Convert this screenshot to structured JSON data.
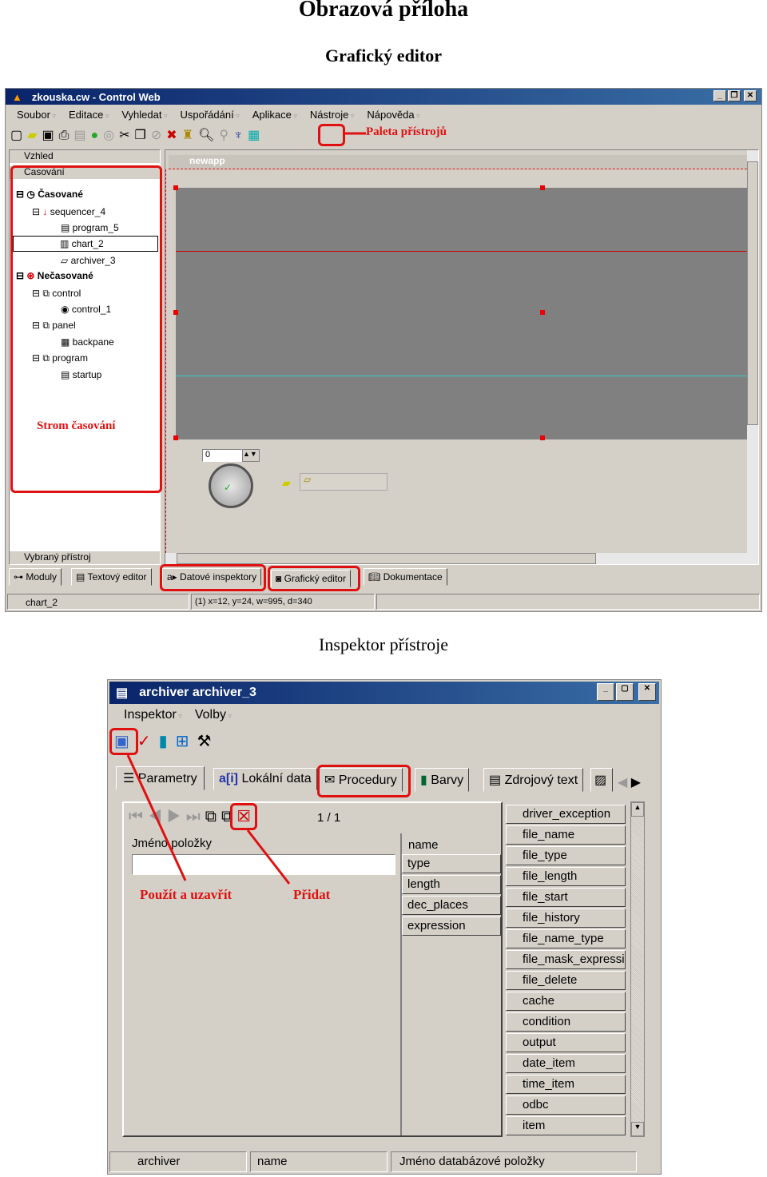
{
  "page": {
    "title": "Obrazová příloha",
    "section1": "Grafický editor",
    "section2": "Inspektor přístroje"
  },
  "editor": {
    "window_title": "zkouska.cw - Control Web",
    "menu": [
      "Soubor",
      "Editace",
      "Vyhledat",
      "Uspořádání",
      "Aplikace",
      "Nástroje",
      "Nápověda"
    ],
    "annotation_palette": "Paleta přístrojů",
    "left_headers": {
      "view": "Vzhled",
      "timing": "Časování",
      "selected": "Vybraný přístroj"
    },
    "tree": [
      "Časované",
      "sequencer_4",
      "program_5",
      "chart_2",
      "archiver_3",
      "Nečasované",
      "control",
      "control_1",
      "panel",
      "backpane",
      "program",
      "startup"
    ],
    "annotation_tree": "Strom časování",
    "canvas_title": "newapp",
    "spin_value": "0",
    "tabs": [
      "Moduly",
      "Textový editor",
      "Datové inspektory",
      "Grafický editor",
      "Dokumentace"
    ],
    "status": {
      "item": "chart_2",
      "coords": "(1) x=12, y=24, w=995, d=340"
    },
    "colors": {
      "annotation": "#e01010",
      "titlebar": "#0a246a",
      "chart_bg": "#808080"
    }
  },
  "inspector": {
    "window_title": "archiver archiver_3",
    "menu": [
      "Inspektor",
      "Volby"
    ],
    "tabs": [
      "Parametry",
      "Lokální data",
      "Procedury",
      "Barvy",
      "Zdrojový text"
    ],
    "page_counter": "1 / 1",
    "field_label": "Jméno položky",
    "field_value": "",
    "annotation_apply": "Použít a uzavřít",
    "annotation_add": "Přidat",
    "columns": [
      "name",
      "type",
      "length",
      "dec_places",
      "expression"
    ],
    "procedures": [
      "driver_exception",
      "file_name",
      "file_type",
      "file_length",
      "file_start",
      "file_history",
      "file_name_type",
      "file_mask_expressi",
      "file_delete",
      "cache",
      "condition",
      "output",
      "date_item",
      "time_item",
      "odbc",
      "item"
    ],
    "status": [
      "archiver",
      "name",
      "Jméno databázové položky"
    ]
  }
}
